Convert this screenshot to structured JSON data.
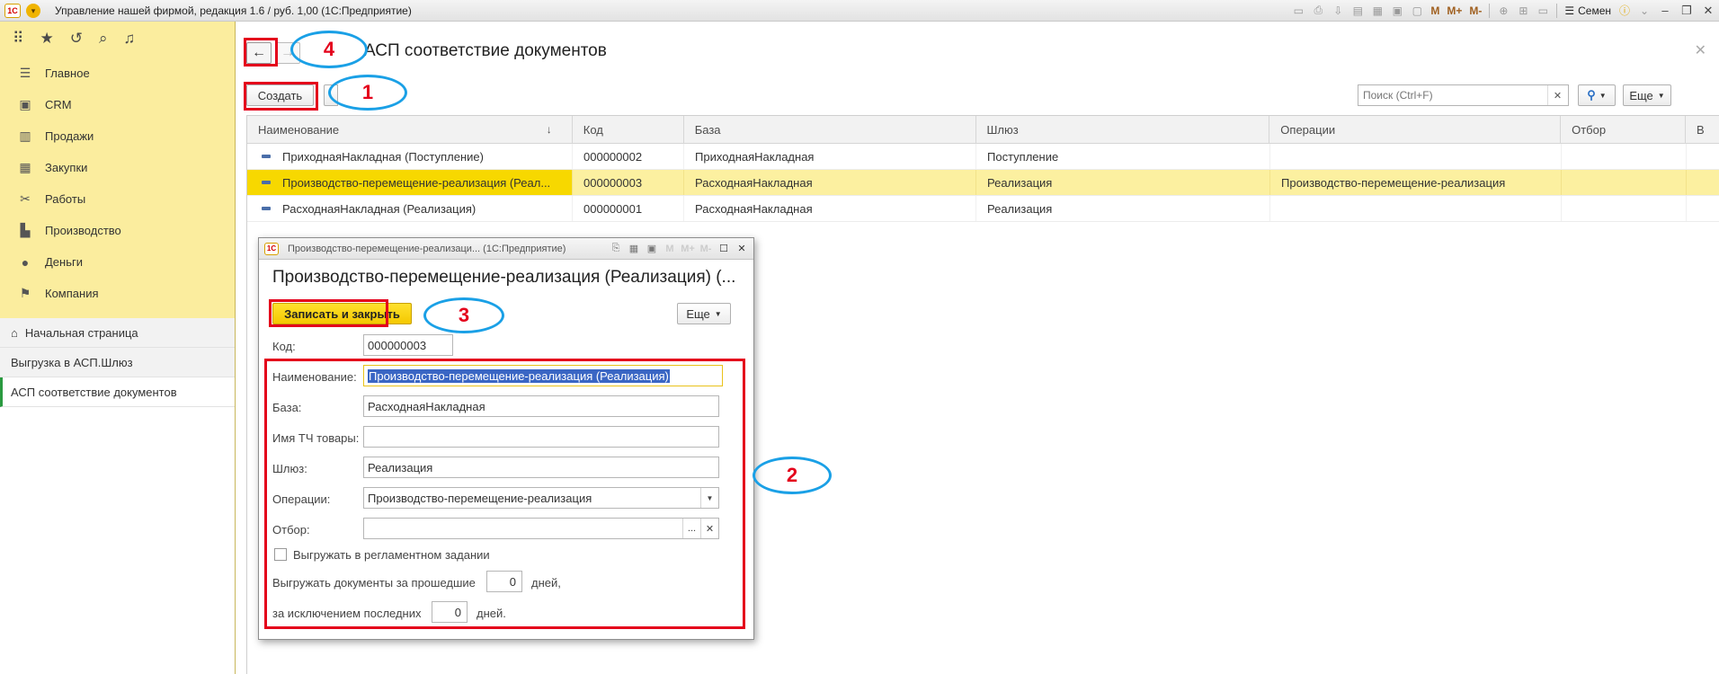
{
  "window": {
    "title": "Управление нашей фирмой, редакция 1.6 / руб. 1,00  (1С:Предприятие)",
    "logo": "1С",
    "user": "Семен",
    "mem_buttons": [
      "M",
      "M+",
      "M-"
    ]
  },
  "sidebar": {
    "sections": [
      {
        "label": "Главное",
        "icon": "list-icon"
      },
      {
        "label": "CRM",
        "icon": "crm-icon"
      },
      {
        "label": "Продажи",
        "icon": "sales-icon"
      },
      {
        "label": "Закупки",
        "icon": "purchases-icon"
      },
      {
        "label": "Работы",
        "icon": "works-icon"
      },
      {
        "label": "Производство",
        "icon": "production-icon"
      },
      {
        "label": "Деньги",
        "icon": "money-icon"
      },
      {
        "label": "Компания",
        "icon": "company-icon"
      }
    ],
    "opened": [
      {
        "label": "Начальная страница"
      },
      {
        "label": "Выгрузка в АСП.Шлюз"
      },
      {
        "label": "АСП соответствие документов"
      }
    ]
  },
  "page": {
    "title": "АСП соответствие документов",
    "create_label": "Создать",
    "search_placeholder": "Поиск (Ctrl+F)",
    "more_label": "Еще",
    "sort_indicator": "↓"
  },
  "table": {
    "columns": [
      "Наименование",
      "Код",
      "База",
      "Шлюз",
      "Операции",
      "Отбор",
      "В"
    ],
    "rows": [
      {
        "name": "ПриходнаяНакладная (Поступление)",
        "code": "000000002",
        "base": "ПриходнаяНакладная",
        "gate": "Поступление",
        "ops": "",
        "filter": ""
      },
      {
        "name": "Производство-перемещение-реализация (Реал...",
        "code": "000000003",
        "base": "РасходнаяНакладная",
        "gate": "Реализация",
        "ops": "Производство-перемещение-реализация",
        "filter": "",
        "selected": true
      },
      {
        "name": "РасходнаяНакладная (Реализация)",
        "code": "000000001",
        "base": "РасходнаяНакладная",
        "gate": "Реализация",
        "ops": "",
        "filter": ""
      }
    ]
  },
  "dialog": {
    "window_title": "Производство-перемещение-реализаци... (1С:Предприятие)",
    "heading": "Производство-перемещение-реализация (Реализация) (...",
    "save_close_label": "Записать и закрыть",
    "more_label": "Еще",
    "code_label": "Код:",
    "code_value": "000000003",
    "name_label": "Наименование:",
    "name_value": "Производство-перемещение-реализация (Реализация)",
    "base_label": "База:",
    "base_value": "РасходнаяНакладная",
    "tc_label": "Имя ТЧ товары:",
    "tc_value": "",
    "gate_label": "Шлюз:",
    "gate_value": "Реализация",
    "ops_label": "Операции:",
    "ops_value": "Производство-перемещение-реализация",
    "filter_label": "Отбор:",
    "filter_value": "",
    "checkbox_label": "Выгружать в регламентном задании",
    "days_prefix": "Выгружать документы за прошедшие",
    "days_value": "0",
    "days_suffix": "дней,",
    "except_prefix": "за исключением последних",
    "except_value": "0",
    "except_suffix": "дней."
  },
  "annotations": {
    "n1": "1",
    "n2": "2",
    "n3": "3",
    "n4": "4",
    "box_color": "#e4001b",
    "ellipse_color": "#1aa0e6"
  }
}
